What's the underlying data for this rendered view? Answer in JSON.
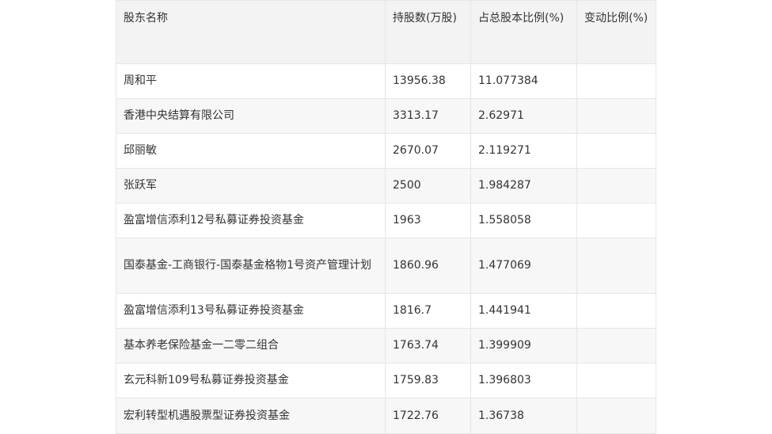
{
  "table": {
    "headers": [
      "股东名称",
      "持股数(万股)",
      "占总股本比例(%)",
      "变动比例(%)"
    ],
    "rows": [
      {
        "name": "周和平",
        "shares": "13956.38",
        "ratio": "11.077384",
        "change": ""
      },
      {
        "name": "香港中央结算有限公司",
        "shares": "3313.17",
        "ratio": "2.62971",
        "change": ""
      },
      {
        "name": "邱丽敏",
        "shares": "2670.07",
        "ratio": "2.119271",
        "change": ""
      },
      {
        "name": "张跃军",
        "shares": "2500",
        "ratio": "1.984287",
        "change": ""
      },
      {
        "name": "盈富增信添利12号私募证券投资基金",
        "shares": "1963",
        "ratio": "1.558058",
        "change": ""
      },
      {
        "name": "国泰基金-工商银行-国泰基金格物1号资产管理计划",
        "shares": "1860.96",
        "ratio": "1.477069",
        "change": ""
      },
      {
        "name": "盈富增信添利13号私募证券投资基金",
        "shares": "1816.7",
        "ratio": "1.441941",
        "change": ""
      },
      {
        "name": "基本养老保险基金一二零二组合",
        "shares": "1763.74",
        "ratio": "1.399909",
        "change": ""
      },
      {
        "name": "玄元科新109号私募证券投资基金",
        "shares": "1759.83",
        "ratio": "1.396803",
        "change": ""
      },
      {
        "name": "宏利转型机遇股票型证券投资基金",
        "shares": "1722.76",
        "ratio": "1.36738",
        "change": ""
      }
    ]
  }
}
